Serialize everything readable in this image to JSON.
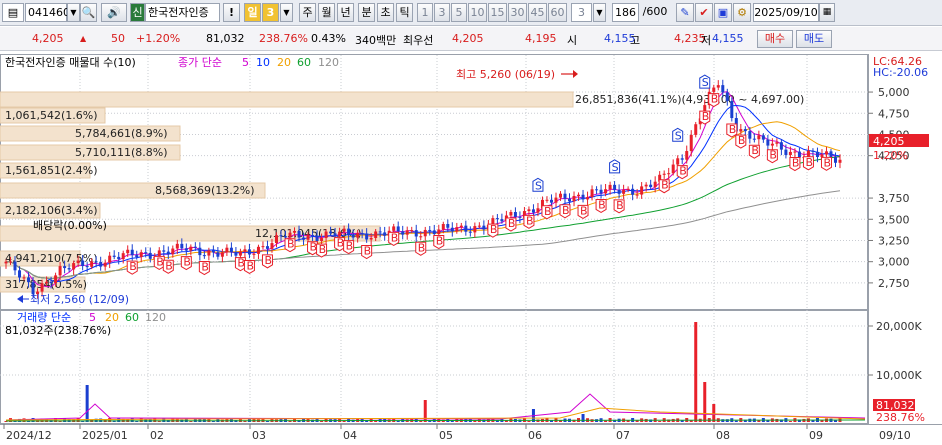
{
  "toolbar": {
    "code": "041460",
    "credit_badge": "신",
    "stock_name": "한국전자인증",
    "warn": "!",
    "period_sel": "일",
    "period_num": "3",
    "periods": [
      "주",
      "월",
      "년",
      "분",
      "초",
      "틱"
    ],
    "minute_options": [
      "1",
      "3",
      "5",
      "10",
      "15",
      "30",
      "45",
      "60"
    ],
    "tick_value": "3",
    "count": "186",
    "count_total": "/600",
    "date": "2025/09/10"
  },
  "quote": {
    "price": "4,205",
    "change": "50",
    "change_pct": "+1.20%",
    "volume": "81,032",
    "volume_ratio": "238.76%",
    "turnover_pct": "0.43%",
    "trade_value": "340백만",
    "best_ask_label": "최우선",
    "best_ask": "4,205",
    "best_bid": "4,195",
    "open_label": "시",
    "open": "4,155",
    "high_label": "고",
    "high": "4,235",
    "low_label": "저",
    "low": "4,155",
    "buy_button": "매수",
    "sell_button": "매도"
  },
  "legend": {
    "title": "한국전자인증 매물대 수(10)",
    "ma_label": "종가 단순",
    "ma_periods": [
      "5",
      "10",
      "20",
      "60",
      "120"
    ],
    "ma_colors": [
      "#d000d0",
      "#0030ff",
      "#f0a000",
      "#10a030",
      "#909090"
    ],
    "lc": "LC:64.26",
    "hc": "HC:-20.06"
  },
  "annotations": {
    "high_marker": "최고 5,260 (06/19)",
    "low_marker": "최저 2,560 (12/09)",
    "dividend": "배당락(0.00%)"
  },
  "volume_profile": [
    {
      "label": "1,061,542(1.6%)",
      "frac": 0.016
    },
    {
      "label": "5,784,661(8.9%)",
      "frac": 0.089
    },
    {
      "label": "5,710,111(8.8%)",
      "frac": 0.088
    },
    {
      "label": "1,561,851(2.4%)",
      "frac": 0.024
    },
    {
      "label": "8,568,369(13.2%)",
      "frac": 0.132
    },
    {
      "label": "2,182,106(3.4%)",
      "frac": 0.034
    },
    {
      "label": "12,101,045(18.6%)",
      "frac": 0.186
    },
    {
      "label": "4,941,210(7.5%)",
      "frac": 0.075
    },
    {
      "label": "317,854(0.5%)",
      "frac": 0.005
    },
    {
      "label": "26,851,836(41.1%)(4,930.00 ~ 4,697.00)",
      "frac": 0.411
    }
  ],
  "price_axis": {
    "ticks": [
      "5,000",
      "4,750",
      "4,500",
      "4,250",
      "3,750",
      "3,500",
      "3,250",
      "3,000",
      "2,750"
    ],
    "current_price": "4,205",
    "current_pct": "1.20%"
  },
  "volume_panel": {
    "title": "거래량 단순",
    "ma_periods": [
      "5",
      "20",
      "60",
      "120"
    ],
    "ma_colors": [
      "#d000d0",
      "#f0a000",
      "#10a030",
      "#909090"
    ],
    "value_text": "81,032주(238.76%)",
    "ticks": [
      "20,000K",
      "10,000K"
    ],
    "current": "81,032",
    "current_pct": "238.76%"
  },
  "x_axis": {
    "labels": [
      "2024/12",
      "2025/01",
      "02",
      "03",
      "04",
      "05",
      "06",
      "07",
      "08",
      "09"
    ],
    "end_label": "09/10"
  },
  "chart_data": {
    "type": "candlestick",
    "x_range": [
      "2024/12",
      "2025/09/10"
    ],
    "y_price_range": [
      2560,
      5260
    ],
    "y_volume_max_k": 20000,
    "high": {
      "value": 5260,
      "date": "06/19"
    },
    "low": {
      "value": 2560,
      "date": "12/09"
    },
    "last": {
      "open": 4155,
      "high": 4235,
      "low": 4155,
      "close": 4205,
      "change_pct": 1.2,
      "volume": 81032
    }
  },
  "colors": {
    "up": "#e8202a",
    "down": "#1a3fd0",
    "profile": "#f3e2cd",
    "profile_border": "#e4c9a8"
  }
}
